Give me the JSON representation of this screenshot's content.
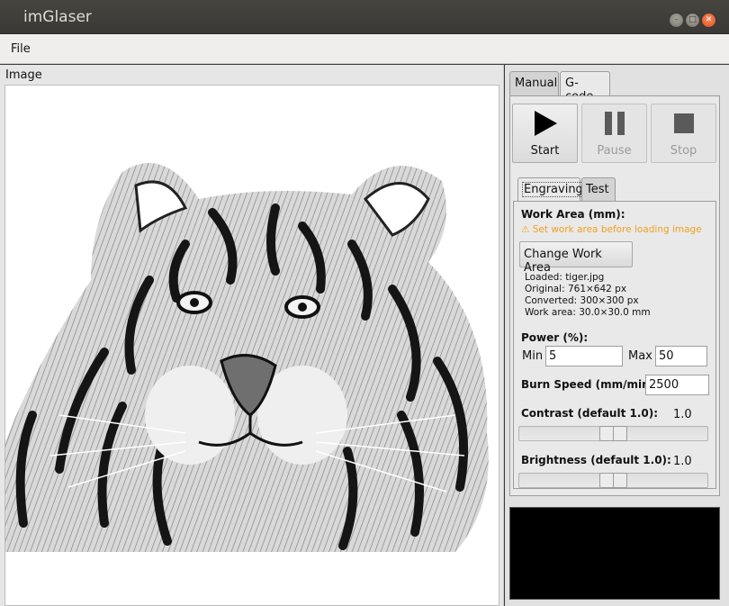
{
  "window": {
    "title": "imGlaser"
  },
  "menu": {
    "file": "File"
  },
  "image_panel": {
    "label": "Image"
  },
  "tabs": {
    "manual": "Manual",
    "gcode": "G-code"
  },
  "controls": {
    "start": "Start",
    "pause": "Pause",
    "stop": "Stop"
  },
  "subtabs": {
    "engraving": "Engraving",
    "test": "Test"
  },
  "engraving": {
    "work_area_label": "Work Area (mm):",
    "warning": "⚠ Set work area before loading image",
    "change_work_area": "Change Work Area",
    "loaded": "Loaded: tiger.jpg",
    "original": "Original: 761×642 px",
    "converted": "Converted: 300×300 px",
    "work_area": "Work area: 30.0×30.0 mm",
    "power_label": "Power (%):",
    "min_label": "Min",
    "min_value": "5",
    "max_label": "Max",
    "max_value": "50",
    "burn_speed_label": "Burn Speed (mm/min):",
    "burn_speed_value": "2500",
    "contrast_label": "Contrast (default 1.0):",
    "contrast_value": "1.0",
    "contrast_level": 0.5,
    "brightness_label": "Brightness (default 1.0):",
    "brightness_value": "1.0",
    "brightness_level": 0.5
  },
  "colors": {
    "warning": "#f0a020",
    "console_bg": "#000000",
    "close_button": "#e95420"
  }
}
